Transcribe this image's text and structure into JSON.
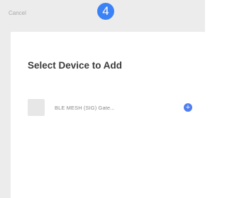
{
  "topbar": {
    "cancel_label": "Cancel",
    "step_number": "4"
  },
  "sheet": {
    "title": "Select Device to Add",
    "devices": [
      {
        "name": "BLE MESH  (SIG)  Gate...",
        "action_icon": "plus-icon",
        "action_symbol": "+"
      }
    ]
  },
  "colors": {
    "background": "#ececec",
    "sheet": "#ffffff",
    "accent": "#3b82f6",
    "add_button": "#4f7ef0"
  }
}
